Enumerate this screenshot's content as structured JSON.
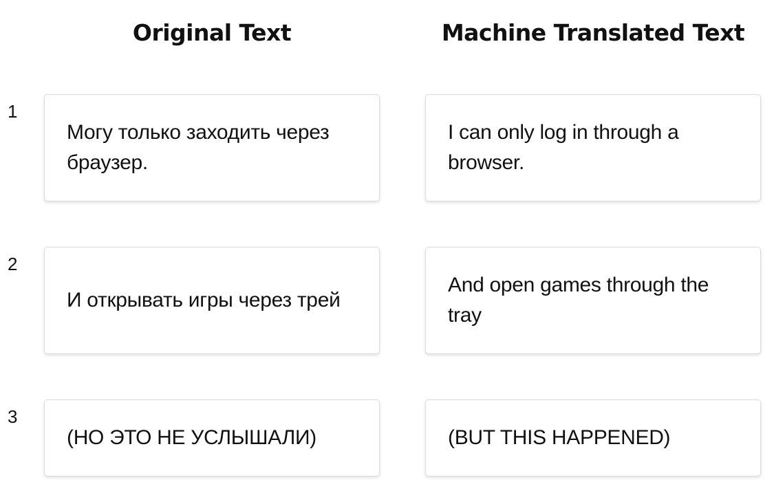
{
  "headers": {
    "original": "Original Text",
    "translated": "Machine Translated Text"
  },
  "rows": [
    {
      "number": "1",
      "original": "Могу только заходить через браузер.",
      "translated": "I can only log in through a browser."
    },
    {
      "number": "2",
      "original": "И открывать игры через трей",
      "translated": "And open games through the tray"
    },
    {
      "number": "3",
      "original": "(НО ЭТО НЕ УСЛЫШАЛИ)",
      "translated": "(BUT THIS HAPPENED)"
    }
  ]
}
